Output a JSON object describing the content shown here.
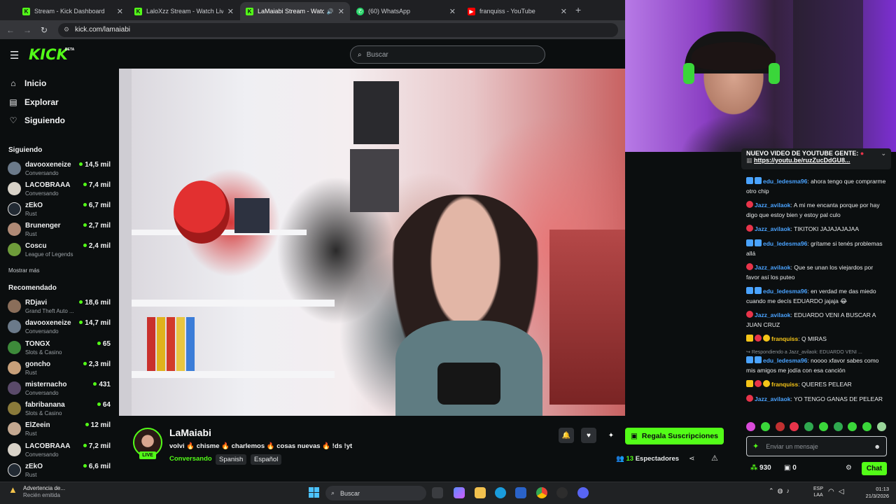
{
  "browser": {
    "tabs": [
      {
        "title": "Stream - Kick Dashboard",
        "favicon": "kick-icon",
        "color": "#53fc18"
      },
      {
        "title": "LaloXzz Stream - Watch Live on",
        "favicon": "kick-icon",
        "color": "#53fc18"
      },
      {
        "title": "LaMaiabi Stream - Watch Live",
        "favicon": "kick-icon",
        "color": "#53fc18",
        "active": true
      },
      {
        "title": "(60) WhatsApp",
        "favicon": "whatsapp-icon",
        "color": "#25d366"
      },
      {
        "title": "franquiss - YouTube",
        "favicon": "youtube-icon",
        "color": "#ff0000"
      }
    ],
    "url": "kick.com/lamaiabi"
  },
  "header": {
    "logo": "KICK",
    "logo_badge": "BETA",
    "search_placeholder": "Buscar"
  },
  "sidebar": {
    "nav": [
      {
        "label": "Inicio",
        "icon": "home-icon"
      },
      {
        "label": "Explorar",
        "icon": "compass-icon"
      },
      {
        "label": "Siguiendo",
        "icon": "heart-icon"
      }
    ],
    "following_title": "Siguiendo",
    "following": [
      {
        "name": "davooxeneize",
        "category": "Conversando",
        "viewers": "14,5 mil",
        "color": "#6b7a8a"
      },
      {
        "name": "LACOBRAAA",
        "category": "Conversando",
        "viewers": "7,4 mil",
        "color": "#d8d2c8"
      },
      {
        "name": "zEkO",
        "category": "Rust",
        "viewers": "6,7 mil",
        "color": "#222a33"
      },
      {
        "name": "Brunenger",
        "category": "Rust",
        "viewers": "2,7 mil",
        "color": "#b08a76"
      },
      {
        "name": "Coscu",
        "category": "League of Legends",
        "viewers": "2,4 mil",
        "color": "#6e9c3a"
      }
    ],
    "show_more": "Mostrar más",
    "recommended_title": "Recomendado",
    "recommended": [
      {
        "name": "RDjavi",
        "category": "Grand Theft Auto ...",
        "viewers": "18,6 mil",
        "color": "#8a6e5a"
      },
      {
        "name": "davooxeneize",
        "category": "Conversando",
        "viewers": "14,7 mil",
        "color": "#6b7a8a"
      },
      {
        "name": "TONGX",
        "category": "Slots & Casino",
        "viewers": "65",
        "color": "#3d8a3a"
      },
      {
        "name": "goncho",
        "category": "Rust",
        "viewers": "2,3 mil",
        "color": "#c8a07a"
      },
      {
        "name": "misternacho",
        "category": "Conversando",
        "viewers": "431",
        "color": "#5a4a6a"
      },
      {
        "name": "fabribanana",
        "category": "Slots & Casino",
        "viewers": "64",
        "color": "#8a7a3a"
      },
      {
        "name": "ElZeein",
        "category": "Rust",
        "viewers": "12 mil",
        "color": "#c4a890"
      },
      {
        "name": "LACOBRAAA",
        "category": "Conversando",
        "viewers": "7,2 mil",
        "color": "#d8d2c8"
      },
      {
        "name": "zEkO",
        "category": "Rust",
        "viewers": "6,6 mil",
        "color": "#222a33"
      }
    ]
  },
  "stream": {
    "streamer": "LaMaiabi",
    "live_badge": "LIVE",
    "title": "volvi 🔥 chisme 🔥 charlemos 🔥 cosas nuevas 🔥 !ds !yt",
    "category": "Conversando",
    "tags": [
      "Spanish",
      "Español"
    ],
    "gift_button": "Regala Suscripciones",
    "viewers_count": "13",
    "viewers_label": "Espectadores"
  },
  "chat": {
    "pinned_title": "NUEVO VIDEO DE YOUTUBE GENTE:",
    "pinned_link": "https://youtu.be/ruzZucDdGU8...",
    "messages": [
      {
        "user": "edu_ledesma96",
        "user_color": "#4aa3ff",
        "text": "ahora tengo que comprarme otro chip",
        "badge_color": "#4aa3ff"
      },
      {
        "user": "Jazz_avilaok",
        "user_color": "#4aa3ff",
        "text": "A mi me encanta porque por hay digo que estoy bien y estoy pal culo",
        "badge_color": "#e8344a"
      },
      {
        "user": "Jazz_avilaok",
        "user_color": "#4aa3ff",
        "text": "TIKITOKI JAJAJAJAJAA",
        "badge_color": "#e8344a"
      },
      {
        "user": "edu_ledesma96",
        "user_color": "#4aa3ff",
        "text": "grítame si tenés problemas allá",
        "badge_color": "#4aa3ff"
      },
      {
        "user": "Jazz_avilaok",
        "user_color": "#4aa3ff",
        "text": "Que se unan los viejardos por favor así los puteo",
        "badge_color": "#e8344a"
      },
      {
        "user": "edu_ledesma96",
        "user_color": "#4aa3ff",
        "text": "en verdad me das miedo cuando me decís EDUARDO jajaja 😂",
        "badge_color": "#4aa3ff"
      },
      {
        "user": "Jazz_avilaok",
        "user_color": "#4aa3ff",
        "text": "EDUARDO VENI A BUSCAR A JUAN CRUZ",
        "badge_color": "#e8344a"
      },
      {
        "user": "franquiss",
        "user_color": "#f5c518",
        "text": "Q MIRAS",
        "badge_color": "#f5c518"
      },
      {
        "user": "edu_ledesma96",
        "user_color": "#4aa3ff",
        "text": "noooo xfavor sabes como mis amigos me jodía con esa canción",
        "badge_color": "#4aa3ff",
        "reply": "Respondiendo a Jazz_avilaok: EDUARDO VENI ..."
      },
      {
        "user": "franquiss",
        "user_color": "#f5c518",
        "text": "QUERES PELEAR",
        "badge_color": "#f5c518"
      },
      {
        "user": "Jazz_avilaok",
        "user_color": "#4aa3ff",
        "text": "YO TENGO GANAS DE PELEAR",
        "badge_color": "#e8344a"
      }
    ],
    "input_placeholder": "Enviar un mensaje",
    "points": "930",
    "subs": "0",
    "chat_button": "Chat"
  },
  "taskbar": {
    "weather_title": "Advertencia de...",
    "weather_sub": "Recién emitida",
    "search": "Buscar",
    "lang_1": "ESP",
    "lang_2": "LAA",
    "time": "01:13",
    "date": "21/3/2026"
  }
}
